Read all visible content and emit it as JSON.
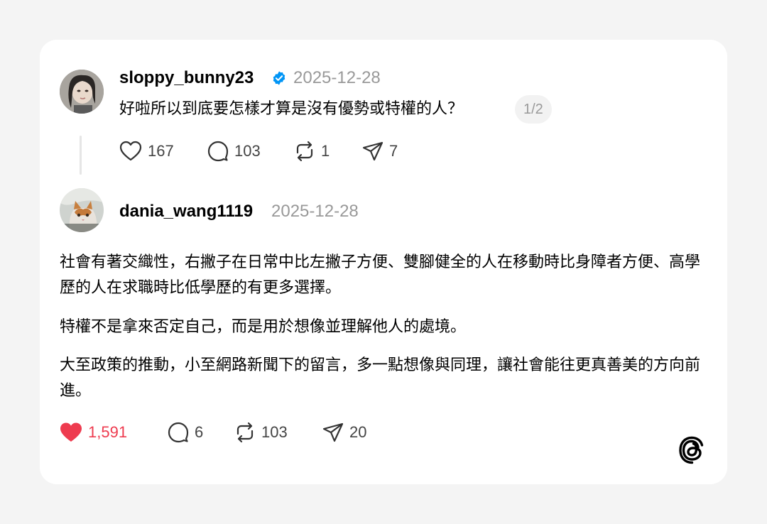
{
  "post1": {
    "username": "sloppy_bunny23",
    "verified": true,
    "date": "2025-12-28",
    "text": "好啦所以到底要怎樣才算是沒有優勢或特權的人？",
    "page_indicator": "1/2",
    "actions": {
      "likes": "167",
      "comments": "103",
      "reposts": "1",
      "shares": "7"
    }
  },
  "post2": {
    "username": "dania_wang1119",
    "date": "2025-12-28",
    "paragraphs": [
      "社會有著交織性，右撇子在日常中比左撇子方便、雙腳健全的人在移動時比身障者方便、高學歷的人在求職時比低學歷的有更多選擇。",
      "特權不是拿來否定自己，而是用於想像並理解他人的處境。",
      "大至政策的推動，小至網路新聞下的留言，多一點想像與同理，讓社會能往更真善美的方向前進。"
    ],
    "actions": {
      "likes": "1,591",
      "liked": true,
      "comments": "6",
      "reposts": "103",
      "shares": "20"
    }
  },
  "colors": {
    "like_active": "#ee3b4f",
    "verified_badge": "#0095f6",
    "muted_text": "#999999"
  },
  "icons": [
    "heart-icon",
    "comment-icon",
    "repost-icon",
    "share-icon",
    "verified-icon",
    "threads-logo-icon"
  ]
}
